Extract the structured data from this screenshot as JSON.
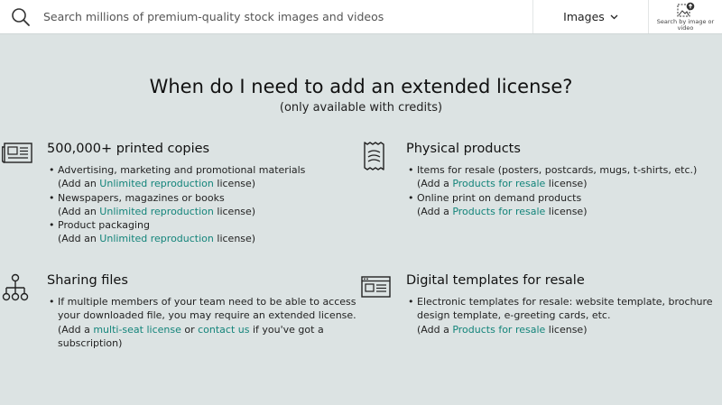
{
  "search": {
    "placeholder": "Search millions of premium-quality stock images and videos",
    "type_label": "Images",
    "visual_search_label": "Search by image or video"
  },
  "heading": {
    "title": "When do I need to add an extended license?",
    "subtitle": "(only available with credits)"
  },
  "sections": {
    "printed": {
      "title": "500,000+ printed copies",
      "items": [
        {
          "text": "Advertising, marketing and promotional materials",
          "pre": "(Add an ",
          "link": "Unlimited reproduction",
          "post": " license)"
        },
        {
          "text": "Newspapers, magazines or books",
          "pre": "(Add an ",
          "link": "Unlimited reproduction",
          "post": " license)"
        },
        {
          "text": "Product packaging",
          "pre": "(Add an ",
          "link": "Unlimited reproduction",
          "post": " license)"
        }
      ]
    },
    "physical": {
      "title": "Physical products",
      "items": [
        {
          "text": "Items for resale (posters, postcards, mugs, t-shirts, etc.)",
          "pre": "(Add a ",
          "link": "Products for resale",
          "post": " license)"
        },
        {
          "text": "Online print on demand products",
          "pre": "(Add a ",
          "link": "Products for resale",
          "post": " license)"
        }
      ]
    },
    "sharing": {
      "title": "Sharing files",
      "items": [
        {
          "text": "If multiple members of your team need to be able to access your downloaded file, you may require an extended license.",
          "pre": "(Add a ",
          "link": "multi-seat license",
          "mid": " or ",
          "link2": "contact us",
          "post": " if you've got a subscription)"
        }
      ]
    },
    "digital": {
      "title": "Digital templates for resale",
      "items": [
        {
          "text": "Electronic templates for resale: website template, brochure design template, e-greeting cards, etc.",
          "pre": "(Add a ",
          "link": "Products for resale",
          "post": " license)"
        }
      ]
    }
  },
  "colors": {
    "background": "#dce3e3",
    "link": "#13847a"
  },
  "icons": {
    "search": "search-icon",
    "chevron": "chevron-down-icon",
    "visual_search": "image-search-icon",
    "printed": "newspaper-icon",
    "physical": "receipt-icon",
    "sharing": "hierarchy-icon",
    "digital": "web-template-icon"
  }
}
